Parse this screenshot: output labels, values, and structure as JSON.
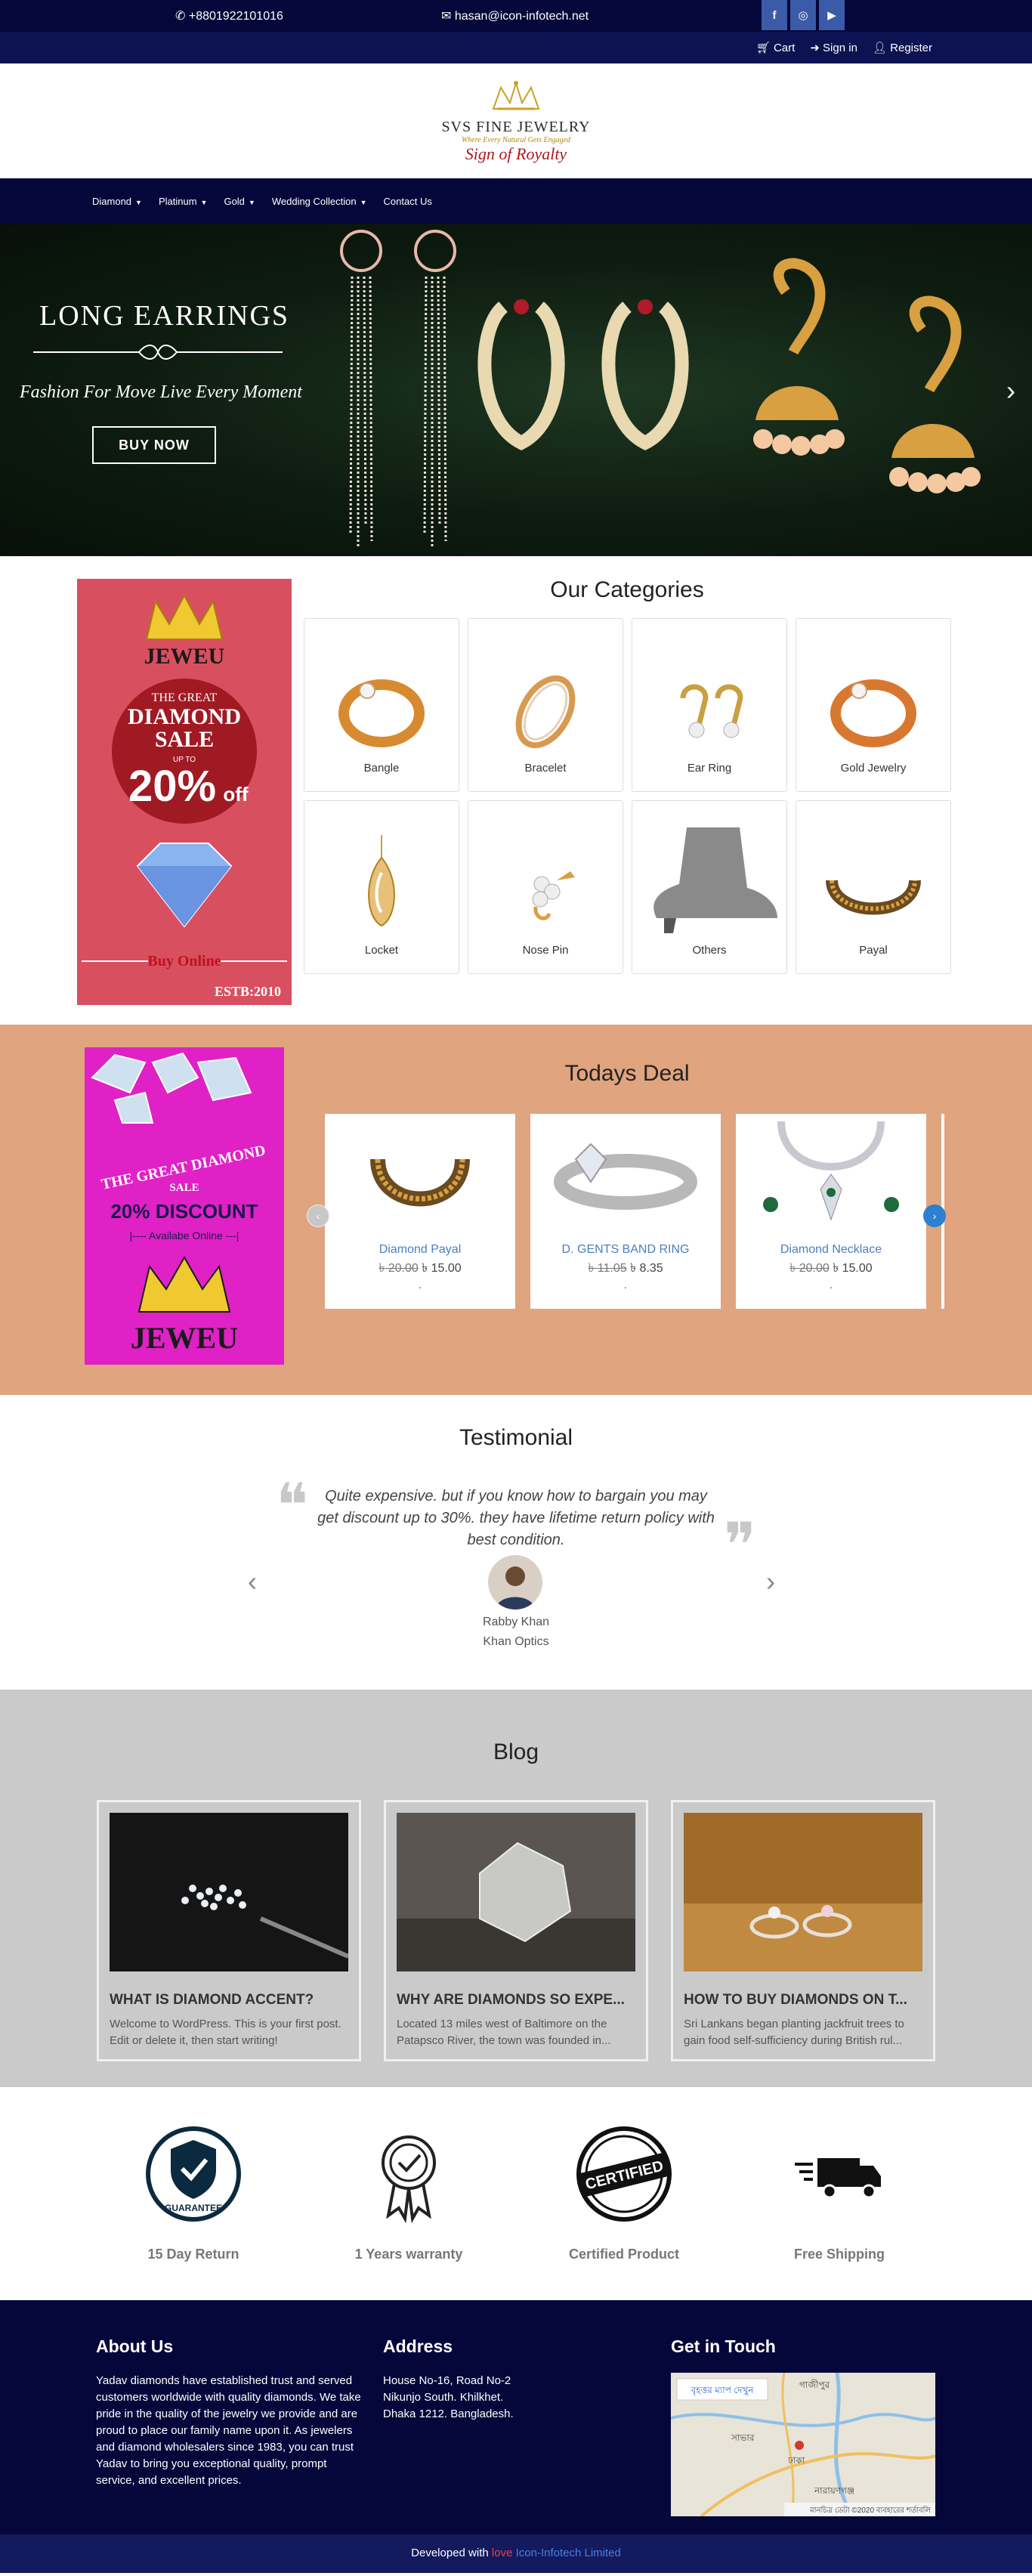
{
  "topbar": {
    "phone": "+8801922101016",
    "email": "hasan@icon-infotech.net",
    "socials": [
      {
        "name": "facebook",
        "glyph": "f"
      },
      {
        "name": "instagram",
        "glyph": "◎"
      },
      {
        "name": "youtube",
        "glyph": "▶"
      }
    ]
  },
  "account": {
    "cart": "Cart",
    "signin": "Sign in",
    "register": "Register"
  },
  "logo": {
    "name": "SVS FINE JEWELRY",
    "tagline": "Where Every Natural Gets Engaged",
    "slogan": "Sign of Royalty"
  },
  "nav": {
    "items": [
      "Diamond",
      "Platinum",
      "Gold",
      "Wedding Collection",
      "Contact Us"
    ]
  },
  "hero": {
    "title": "LONG EARRINGS",
    "subtitle": "Fashion For Move Live Every Moment",
    "button": "BUY NOW"
  },
  "promo1": {
    "brand": "JEWEU",
    "line1": "THE GREAT",
    "line2": "DIAMOND",
    "line3": "SALE",
    "upto": "UP TO",
    "percent": "20%",
    "off": "off",
    "cta": "Buy Online",
    "estb": "ESTB:2010"
  },
  "categories": {
    "title": "Our Categories",
    "items": [
      "Bangle",
      "Bracelet",
      "Ear Ring",
      "Gold Jewelry",
      "Locket",
      "Nose Pin",
      "Others",
      "Payal"
    ]
  },
  "promo2": {
    "line1": "THE GREAT DIAMOND",
    "line2": "SALE",
    "discount": "20% DISCOUNT",
    "available": "|---- Availabe Online ---|",
    "brand": "JEWEU"
  },
  "deal": {
    "title": "Todays Deal",
    "products": [
      {
        "name": "Diamond Payal",
        "old_price": "৳ 20.00",
        "new_price": "৳ 15.00",
        "extra": "."
      },
      {
        "name": "D. GENTS BAND RING",
        "old_price": "৳ 11.05",
        "new_price": "৳ 8.35",
        "extra": "."
      },
      {
        "name": "Diamond Necklace",
        "old_price": "৳ 20.00",
        "new_price": "৳ 15.00",
        "extra": "."
      }
    ]
  },
  "testimonial": {
    "title": "Testimonial",
    "quote": "Quite expensive. but if you know how to bargain you may get discount up to 30%. they have lifetime return policy with best condition.",
    "name": "Rabby Khan",
    "company": "Khan Optics"
  },
  "blog": {
    "title": "Blog",
    "posts": [
      {
        "title": "WHAT IS DIAMOND ACCENT?",
        "excerpt": "Welcome to WordPress. This is your first post. Edit or delete it, then start writing!"
      },
      {
        "title": "WHY ARE DIAMONDS SO EXPE...",
        "excerpt": "Located 13 miles west of Baltimore on the Patapsco River, the town was founded in..."
      },
      {
        "title": "HOW TO BUY DIAMONDS ON T...",
        "excerpt": "Sri Lankans began planting jackfruit trees to gain food self-sufficiency during British rul..."
      }
    ]
  },
  "features": [
    {
      "label": "15 Day Return",
      "icon": "guarantee-shield-icon",
      "badge": "GUARANTEE"
    },
    {
      "label": "1 Years warranty",
      "icon": "award-ribbon-icon"
    },
    {
      "label": "Certified Product",
      "icon": "certified-stamp-icon",
      "badge": "CERTIFIED"
    },
    {
      "label": "Free Shipping",
      "icon": "delivery-truck-icon"
    }
  ],
  "footer": {
    "about_title": "About Us",
    "about_text": "Yadav diamonds have established trust and served customers worldwide with quality diamonds.   We take pride in the quality of the jewelry we provide and are proud to place our family name upon it. As jewelers and diamond wholesalers since 1983, you can trust Yadav to bring you exceptional quality, prompt service, and excellent prices.",
    "address_title": "Address",
    "address_lines": [
      "House No-16, Road No-2",
      "Nikunjo South. Khilkhet.",
      "Dhaka 1212. Bangladesh."
    ],
    "contact_title": "Get in Touch",
    "map_button": "বৃহত্তর ম্যাপ দেখুন",
    "map_labels": [
      "গাজীপুর",
      "সাভার",
      "ঢাকা",
      "নারায়ণগঞ্জ"
    ],
    "map_footer": "মানচিত্র ডেটা ©2020   ব্যবহারের শর্তাবলি"
  },
  "copyright": {
    "prefix": "Developed with",
    "love": "love",
    "company": "Icon-Infotech Limited"
  }
}
